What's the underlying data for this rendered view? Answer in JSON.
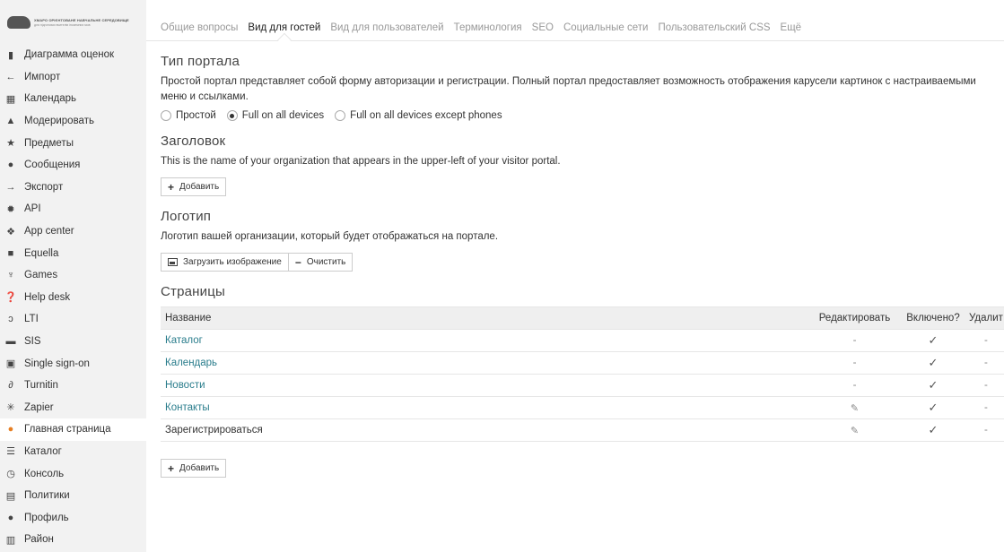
{
  "logo": {
    "line1": "ХМАРО ОРІЄНТОВАНЕ НАВЧАЛЬНЕ СЕРЕДОВИЩЕ",
    "line2": "для підготовки вчителів іноземних мов"
  },
  "sidebar": {
    "items": [
      {
        "label": "Диаграмма оценок",
        "icon": "bar-chart-icon"
      },
      {
        "label": "Импорт",
        "icon": "arrow-left-icon"
      },
      {
        "label": "Календарь",
        "icon": "calendar-icon"
      },
      {
        "label": "Модерировать",
        "icon": "thumbs-up-icon"
      },
      {
        "label": "Предметы",
        "icon": "star-icon"
      },
      {
        "label": "Сообщения",
        "icon": "chat-icon"
      },
      {
        "label": "Экспорт",
        "icon": "arrow-right-icon"
      },
      {
        "label": "API",
        "icon": "gear-icon"
      },
      {
        "label": "App center",
        "icon": "apps-icon"
      },
      {
        "label": "Equella",
        "icon": "equella-icon"
      },
      {
        "label": "Games",
        "icon": "trophy-icon"
      },
      {
        "label": "Help desk",
        "icon": "help-icon"
      },
      {
        "label": "LTI",
        "icon": "wrench-icon"
      },
      {
        "label": "SIS",
        "icon": "database-icon"
      },
      {
        "label": "Single sign-on",
        "icon": "lock-icon"
      },
      {
        "label": "Turnitin",
        "icon": "turnitin-icon"
      },
      {
        "label": "Zapier",
        "icon": "zapier-icon"
      },
      {
        "label": "Главная страница",
        "icon": "home-page-icon",
        "active": true
      },
      {
        "label": "Каталог",
        "icon": "list-icon"
      },
      {
        "label": "Консоль",
        "icon": "console-icon"
      },
      {
        "label": "Политики",
        "icon": "policy-lock-icon"
      },
      {
        "label": "Профиль",
        "icon": "info-icon"
      },
      {
        "label": "Район",
        "icon": "building-icon"
      }
    ]
  },
  "tabs": [
    {
      "label": "Общие вопросы"
    },
    {
      "label": "Вид для гостей",
      "active": true
    },
    {
      "label": "Вид для пользователей"
    },
    {
      "label": "Терминология"
    },
    {
      "label": "SEO"
    },
    {
      "label": "Социальные сети"
    },
    {
      "label": "Пользовательский CSS"
    },
    {
      "label": "Ещё"
    }
  ],
  "portal_type": {
    "title": "Тип портала",
    "description": "Простой портал представляет собой форму авторизации и регистрации. Полный портал предоставляет возможность отображения карусели картинок с настраиваемыми меню и ссылками.",
    "options": [
      {
        "label": "Простой",
        "selected": false
      },
      {
        "label": "Full on all devices",
        "selected": true
      },
      {
        "label": "Full on all devices except phones",
        "selected": false
      }
    ]
  },
  "header_section": {
    "title": "Заголовок",
    "description": "This is the name of your organization that appears in the upper-left of your visitor portal.",
    "add_label": "Добавить"
  },
  "logo_section": {
    "title": "Логотип",
    "description": "Логотип вашей организации, который будет отображаться на портале.",
    "upload_label": "Загрузить изображение",
    "clear_label": "Очистить"
  },
  "pages": {
    "title": "Страницы",
    "columns": [
      "Название",
      "Редактировать",
      "Включено?",
      "Удалит"
    ],
    "rows": [
      {
        "name": "Каталог",
        "link": true,
        "edit": "-",
        "enabled": "✓",
        "delete": "-"
      },
      {
        "name": "Календарь",
        "link": true,
        "edit": "-",
        "enabled": "✓",
        "delete": "-"
      },
      {
        "name": "Новости",
        "link": true,
        "edit": "-",
        "enabled": "✓",
        "delete": "-"
      },
      {
        "name": "Контакты",
        "link": true,
        "edit": "pencil",
        "enabled": "✓",
        "delete": "-"
      },
      {
        "name": "Зарегистрироваться",
        "link": false,
        "edit": "pencil",
        "enabled": "✓",
        "delete": "-"
      }
    ],
    "add_label": "Добавить"
  }
}
